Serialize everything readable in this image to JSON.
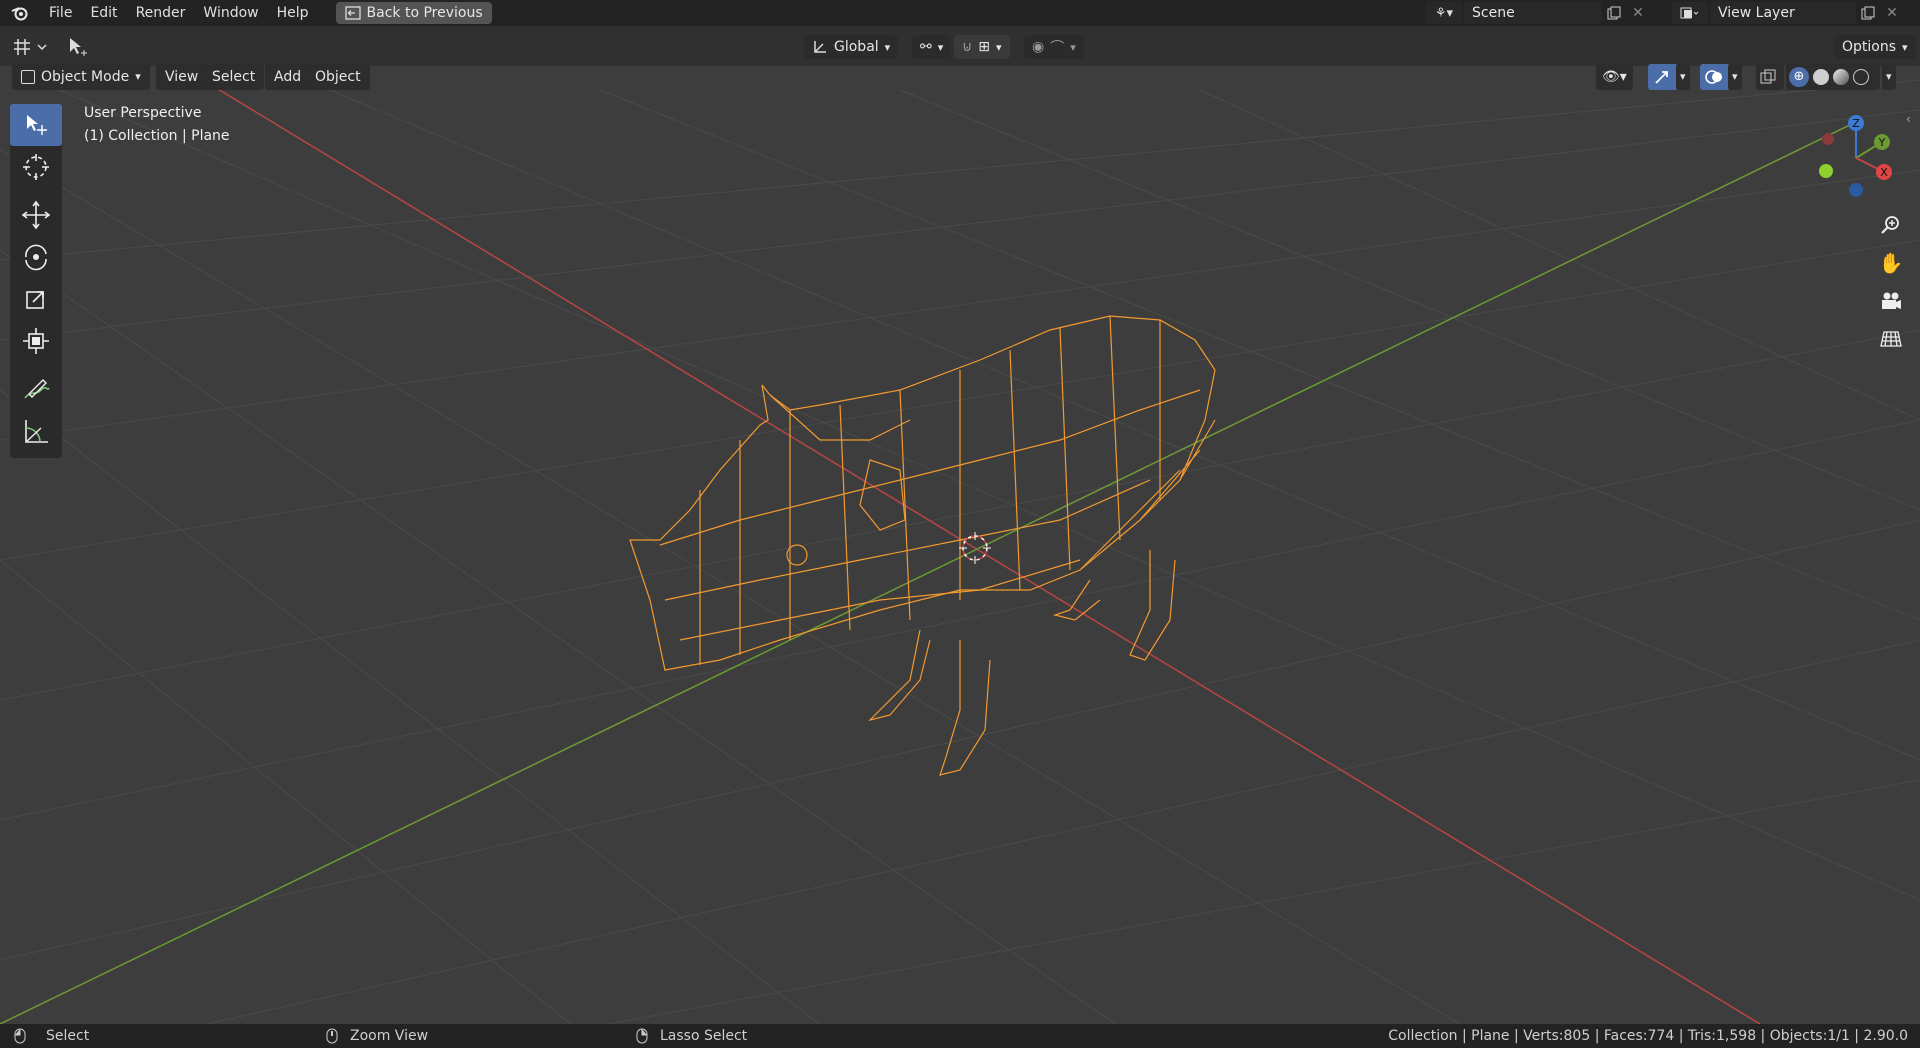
{
  "menu": {
    "file": "File",
    "edit": "Edit",
    "render": "Render",
    "window": "Window",
    "help": "Help",
    "back_to_previous": "Back to Previous"
  },
  "scene": {
    "name": "Scene",
    "view_layer": "View Layer"
  },
  "header": {
    "orientation": "Global",
    "options": "Options"
  },
  "viewport_menu": {
    "mode": "Object Mode",
    "view": "View",
    "select": "Select",
    "add": "Add",
    "object": "Object"
  },
  "viewport_info": {
    "perspective": "User Perspective",
    "collection": "(1) Collection | Plane"
  },
  "gizmo": {
    "z": "Z",
    "y": "Y",
    "x": "X"
  },
  "status": {
    "select": "Select",
    "zoom": "Zoom View",
    "lasso": "Lasso Select",
    "stats": "Collection | Plane | Verts:805 | Faces:774 | Tris:1,598 | Objects:1/1 | 2.90.0"
  },
  "colors": {
    "accent": "#4b6ea8",
    "selection": "#f0a030",
    "x_axis": "#c04545",
    "y_axis": "#6a9a30",
    "z_axis": "#3a7bd5"
  },
  "icons": [
    "blender-logo-icon",
    "back-icon",
    "scene-icon",
    "copy-icon",
    "close-icon",
    "view-layer-icon",
    "editor-type-icon",
    "cursor-tool-icon",
    "orientation-icon",
    "pivot-icon",
    "snap-icon",
    "proportional-icon",
    "mode-icon",
    "select-box-icon",
    "cursor-icon",
    "move-icon",
    "rotate-icon",
    "scale-icon",
    "transform-icon",
    "annotate-icon",
    "measure-icon",
    "zoom-icon",
    "pan-icon",
    "camera-icon",
    "grid-icon",
    "visibility-icon",
    "gizmo-icon",
    "overlay-icon",
    "xray-icon",
    "wireframe-shading-icon",
    "solid-shading-icon",
    "material-shading-icon",
    "rendered-shading-icon",
    "mouse-left-icon",
    "mouse-middle-icon",
    "mouse-right-icon"
  ]
}
